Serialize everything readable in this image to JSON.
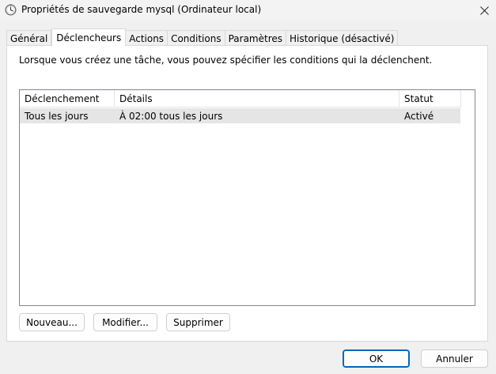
{
  "window": {
    "title": "Propriétés de sauvegarde mysql (Ordinateur local)"
  },
  "tabs": [
    {
      "label": "Général",
      "active": false
    },
    {
      "label": "Déclencheurs",
      "active": true
    },
    {
      "label": "Actions",
      "active": false
    },
    {
      "label": "Conditions",
      "active": false
    },
    {
      "label": "Paramètres",
      "active": false
    },
    {
      "label": "Historique (désactivé)",
      "active": false
    }
  ],
  "panel": {
    "description": "Lorsque vous créez une tâche, vous pouvez spécifier les conditions qui la déclenchent.",
    "columns": [
      "Déclenchement",
      "Détails",
      "Statut"
    ],
    "rows": [
      {
        "trigger": "Tous les jours",
        "details": "À 02:00 tous les jours",
        "status": "Activé"
      }
    ],
    "buttons": {
      "new": "Nouveau...",
      "edit": "Modifier...",
      "delete": "Supprimer"
    }
  },
  "footer": {
    "ok": "OK",
    "cancel": "Annuler"
  },
  "colors": {
    "accent": "#0067c0",
    "row_selected": "#e5e5e5"
  }
}
